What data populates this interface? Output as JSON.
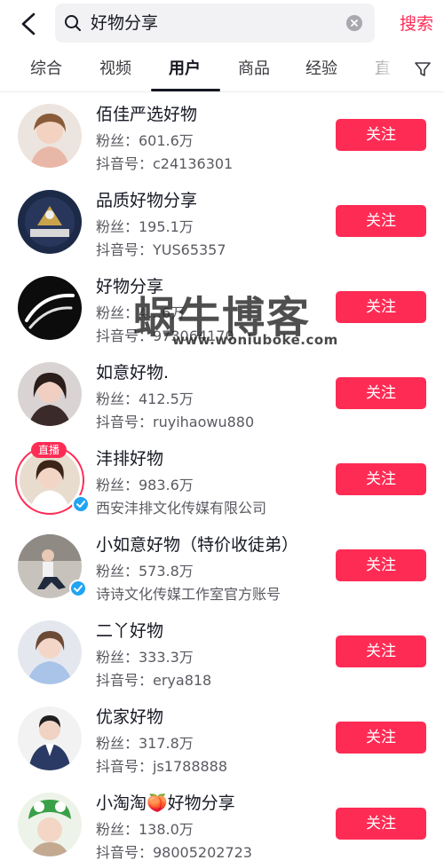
{
  "search": {
    "query": "好物分享",
    "button_label": "搜索"
  },
  "tabs": [
    {
      "label": "综合"
    },
    {
      "label": "视频"
    },
    {
      "label": "用户"
    },
    {
      "label": "商品"
    },
    {
      "label": "经验"
    },
    {
      "label": "直"
    }
  ],
  "active_tab": "用户",
  "colors": {
    "accent": "#fe2c55",
    "verified": "#20a4f3"
  },
  "users": [
    {
      "name": "佰佳严选好物",
      "fans": "粉丝：601.6万",
      "sub": "抖音号：c24136301",
      "follow_label": "关注"
    },
    {
      "name": "品质好物分享",
      "fans": "粉丝：195.1万",
      "sub": "抖音号：YUS65357",
      "follow_label": "关注"
    },
    {
      "name": "好物分享",
      "fans": "粉丝：4…6万",
      "sub": "抖音号：973064170",
      "follow_label": "关注"
    },
    {
      "name": "如意好物.",
      "fans": "粉丝：412.5万",
      "sub": "抖音号：ruyihaowu880",
      "follow_label": "关注"
    },
    {
      "name": "沣排好物",
      "fans": "粉丝：983.6万",
      "sub": "西安沣排文化传媒有限公司",
      "follow_label": "关注",
      "live_badge": "直播"
    },
    {
      "name": "小如意好物（特价收徒弟）",
      "fans": "粉丝：573.8万",
      "sub": "诗诗文化传媒工作室官方账号",
      "follow_label": "关注"
    },
    {
      "name": "二丫好物",
      "fans": "粉丝：333.3万",
      "sub": "抖音号：erya818",
      "follow_label": "关注"
    },
    {
      "name": "优家好物",
      "fans": "粉丝：317.8万",
      "sub": "抖音号：js1788888",
      "follow_label": "关注"
    },
    {
      "name": "小淘淘🍑好物分享",
      "fans": "粉丝：138.0万",
      "sub": "抖音号：98005202723",
      "follow_label": "关注"
    }
  ],
  "watermark": {
    "text": "蜗牛博客",
    "url": "www.woniuboke.com"
  }
}
